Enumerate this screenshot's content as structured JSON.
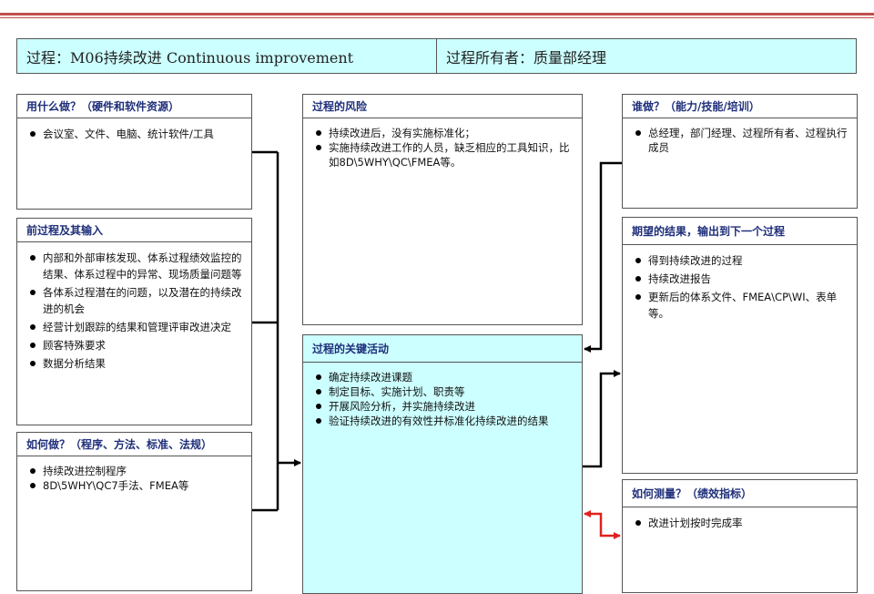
{
  "header": {
    "process": "过程：M06持续改进 Continuous improvement",
    "owner": "过程所有者：质量部经理"
  },
  "boxes": {
    "resources": {
      "title": "用什么做？（硬件和软件资源）",
      "items": [
        "会议室、文件、电脑、统计软件/工具"
      ]
    },
    "inputs": {
      "title": "前过程及其输入",
      "items": [
        "内部和外部审核发现、体系过程绩效监控的结果、体系过程中的异常、现场质量问题等",
        "各体系过程潜在的问题，以及潜在的持续改进的机会",
        "经营计划跟踪的结果和管理评审改进决定",
        "顾客特殊要求",
        "数据分析结果"
      ]
    },
    "methods": {
      "title": "如何做？（程序、方法、标准、法规）",
      "items": [
        "持续改进控制程序",
        "8D\\5WHY\\QC7手法、FMEA等"
      ]
    },
    "risks": {
      "title": "过程的风险",
      "items": [
        "持续改进后，没有实施标准化；",
        "实施持续改进工作的人员，缺乏相应的工具知识，比如8D\\5WHY\\QC\\FMEA等。"
      ]
    },
    "activities": {
      "title": "过程的关键活动",
      "items": [
        "确定持续改进课题",
        "制定目标、实施计划、职责等",
        "开展风险分析，并实施持续改进",
        "验证持续改进的有效性并标准化持续改进的结果"
      ]
    },
    "who": {
      "title": "谁做？（能力/技能/培训）",
      "items": [
        "总经理，部门经理、过程所有者、过程执行成员"
      ]
    },
    "outputs": {
      "title": "期望的结果，输出到下一个过程",
      "items": [
        "得到持续改进的过程",
        "持续改进报告",
        "更新后的体系文件、FMEA\\CP\\WI、表单等。"
      ]
    },
    "measures": {
      "title": "如何测量？（绩效指标）",
      "items": [
        "改进计划按时完成率"
      ]
    }
  },
  "colors": {
    "header_bg": "#ccffff",
    "activity_bg": "#ccffff",
    "title_text": "#1f2f7a",
    "rule": "#c0504d",
    "measure_arrow": "#e02020"
  }
}
